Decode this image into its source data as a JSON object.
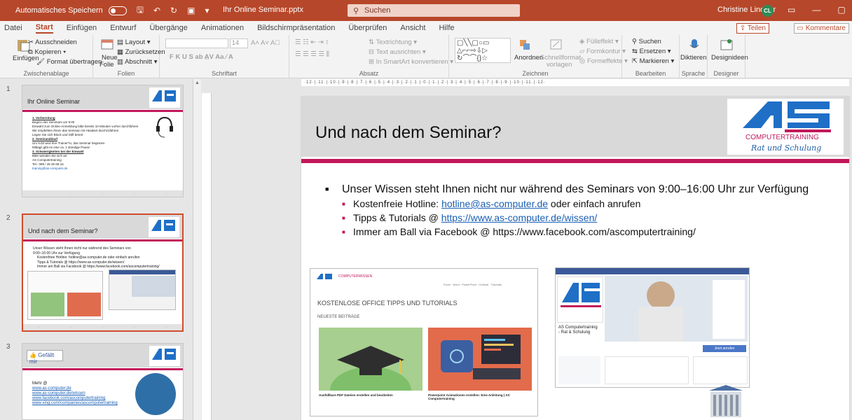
{
  "titlebar": {
    "autosave_label": "Automatisches Speichern",
    "filename": "Ihr Online Seminar.pptx",
    "search_placeholder": "Suchen",
    "user_name": "Christine Lindner",
    "user_initials": "CL"
  },
  "menu": {
    "items": [
      "Datei",
      "Start",
      "Einfügen",
      "Entwurf",
      "Übergänge",
      "Animationen",
      "Bildschirmpräsentation",
      "Überprüfen",
      "Ansicht",
      "Hilfe"
    ],
    "active": "Start",
    "share_label": "Teilen",
    "comments_label": "Kommentare"
  },
  "ribbon": {
    "clipboard": {
      "paste": "Einfügen",
      "cut": "Ausschneiden",
      "copy": "Kopieren",
      "format": "Format übertragen",
      "label": "Zwischenablage"
    },
    "slides": {
      "new": "Neue",
      "new2": "Folie",
      "layout": "Layout",
      "reset": "Zurücksetzen",
      "section": "Abschnitt",
      "label": "Folien"
    },
    "font": {
      "size": "14",
      "label": "Schriftart"
    },
    "paragraph": {
      "direction": "Textrichtung",
      "align": "Text ausrichten",
      "smartart": "In SmartArt konvertieren",
      "label": "Absatz"
    },
    "drawing": {
      "arrange": "Anordnen",
      "quickstyles": "Schnellformat-",
      "quickstyles2": "vorlagen",
      "fill": "Fülleffekt",
      "outline": "Formkontur",
      "effects": "Formeffekte",
      "label": "Zeichnen"
    },
    "editing": {
      "find": "Suchen",
      "replace": "Ersetzen",
      "select": "Markieren",
      "label": "Bearbeiten"
    },
    "voice": {
      "dictate": "Diktieren",
      "label": "Sprache"
    },
    "designer": {
      "ideas": "Designideen",
      "label": "Designer"
    }
  },
  "ruler": "·12·|·11·|·10·|·9·|·8·|·7·|·6·|·5·|·4·|·3·|·2·|·1·|·0·|·1·|·2·|·3·|·4·|·5·|·6·|·7·|·8·|·9·|·10·|·11·|·12·",
  "thumbnails": [
    {
      "num": "1",
      "title": "Ihr Online Seminar",
      "lines": [
        "1. Vorbereitung",
        "Beginn des Seminars um 9:00",
        "Einwahl zum Online-Anmeldung bitte bereits 10 Minuten vorher durchführen",
        "Wir empfehlen Ihnen das Seminar mit Headset durchzuführen",
        "Legen Sie sich Block und Stift bereit",
        "2. Seminarablauf",
        "Um 9:00 wird Ihre Trainer*in, das Seminar beginnen",
        "Mittags gibt es eine ca. 1 stündige Pause",
        "3. Schwierigkeiten bei der Einwahl",
        "Bitte wenden Sie sich an:",
        "AS Computertraining",
        "Tel.: 089 / 45 35 65-15",
        "training@as-computer.de"
      ]
    },
    {
      "num": "2",
      "title": "Und nach dem Seminar?",
      "lines": [
        "Unser Wissen steht Ihnen nicht nur während des Seminars von",
        "9:00–16:00 Uhr zur Verfügung",
        "Kostenfreie Hotline: hotline@as-computer.de oder einfach anrufen",
        "Tipps & Tutorials @ https://www.as-computer.de/wissen/",
        "Immer am Ball via Facebook @ https://www.facebook.com/ascomputertraining/"
      ]
    },
    {
      "num": "3",
      "title": "Gefällt mir",
      "lines": [
        "Mehr @",
        "www.as-computer.de",
        "www.as-computer.de/wissen",
        "www.facebook.com/ascomputertraining",
        "www.xing.com/companies/ascomputertraining"
      ]
    }
  ],
  "slide": {
    "title": "Und nach dem Seminar?",
    "logo_text": "COMPUTERTRAINING",
    "logo_tagline": "Rat und Schulung",
    "bullet_main": "Unser Wissen steht Ihnen nicht nur während des Seminars von 9:00–16:00 Uhr zur Verfügung",
    "sub1_pre": "Kostenfreie Hotline: ",
    "sub1_link": "hotline@as-computer.de",
    "sub1_post": " oder einfach anrufen",
    "sub2_pre": "Tipps & Tutorials @ ",
    "sub2_link": "https://www.as-computer.de/wissen/",
    "sub3": "Immer am Ball via Facebook @ https://www.facebook.com/ascomputertraining/",
    "shot1_heading": "KOSTENLOSE OFFICE TIPPS UND TUTORIALS",
    "shot1_sub": "NEUESTE BEITRÄGE",
    "shot1_brand": "COMPUTERWISSEN",
    "shot1_card1": "Ausfüllbare PDF Dateien erstellen und bearbeiten",
    "shot1_card2": "Powerpoint Animationen erstellen: Eine Anleitung | AS Computertraining",
    "shot2_name": "AS Computertraining - Rat & Schulung",
    "shot2_btn": "Jetzt anrufen"
  }
}
